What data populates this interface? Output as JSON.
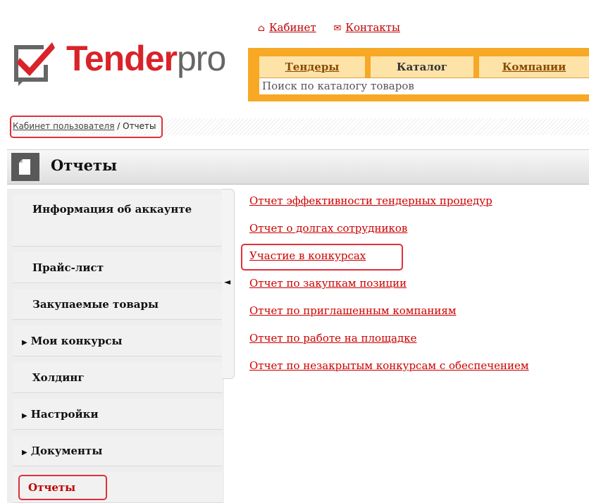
{
  "header": {
    "logo": {
      "brand_bold": "Tender",
      "brand_light": "pro"
    },
    "top_links": [
      {
        "icon": "home-icon",
        "glyph": "⌂",
        "label": "Кабинет"
      },
      {
        "icon": "envelope-icon",
        "glyph": "✉",
        "label": "Контакты"
      }
    ],
    "tabs": [
      {
        "label": "Тендеры",
        "link": true
      },
      {
        "label": "Каталог",
        "link": false
      },
      {
        "label": "Компании",
        "link": true
      }
    ],
    "search": {
      "value": "Поиск по каталогу товаров"
    }
  },
  "breadcrumb": {
    "home": "Кабинет пользователя",
    "separator": " / ",
    "current": "Отчеты"
  },
  "page": {
    "title": "Отчеты",
    "icon": "document-icon"
  },
  "sidebar": {
    "collapse_arrow": "◄",
    "items": [
      {
        "label": "Информация об аккаунте",
        "expandable": false
      },
      {
        "label": "Прайс-лист",
        "expandable": false
      },
      {
        "label": "Закупаемые товары",
        "expandable": false
      },
      {
        "label": "Мои конкурсы",
        "expandable": true
      },
      {
        "label": "Холдинг",
        "expandable": false
      },
      {
        "label": "Настройки",
        "expandable": true
      },
      {
        "label": "Документы",
        "expandable": true
      },
      {
        "label": "Отчеты",
        "expandable": false,
        "active": true
      }
    ]
  },
  "reports": [
    "Отчет эффективности тендерных процедур",
    "Отчет о долгах сотрудников",
    "Участие в конкурсах",
    "Отчет по закупкам позиции",
    "Отчет по приглашенным компаниям",
    "Отчет по работе на площадке",
    "Отчет по незакрытым конкурсам с обеспечением"
  ],
  "colors": {
    "accent": "#f7a824",
    "link": "#cc0000",
    "brand_red": "#d9232a",
    "highlight": "#e0303a"
  }
}
